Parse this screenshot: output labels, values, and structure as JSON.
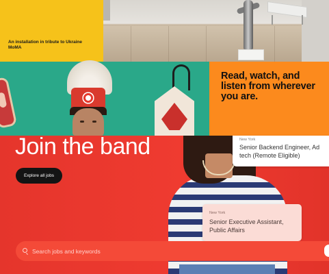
{
  "moma_banner": {
    "caption": "An installation in tribute to Ukraine\nMoMA"
  },
  "promo": {
    "heading": "Read, watch, and listen from wherever you are."
  },
  "careers": {
    "title": "Join the band",
    "explore_label": "Explore all jobs",
    "jobs": [
      {
        "location": "New York",
        "title": "Senior Backend Engineer, Ad tech (Remote Eligible)"
      },
      {
        "location": "New York",
        "title": "Senior Executive Assistant, Public Affairs"
      }
    ],
    "search": {
      "placeholder": "Search jobs and keywords",
      "value": ""
    }
  },
  "icons": {
    "search": "search-icon"
  },
  "colors": {
    "moma_yellow": "#f6c21a",
    "promo_orange": "#fc8a1d",
    "careers_red": "#e8342b",
    "explore_button": "#141414",
    "job_card_highlight": "#fbdcd6"
  }
}
